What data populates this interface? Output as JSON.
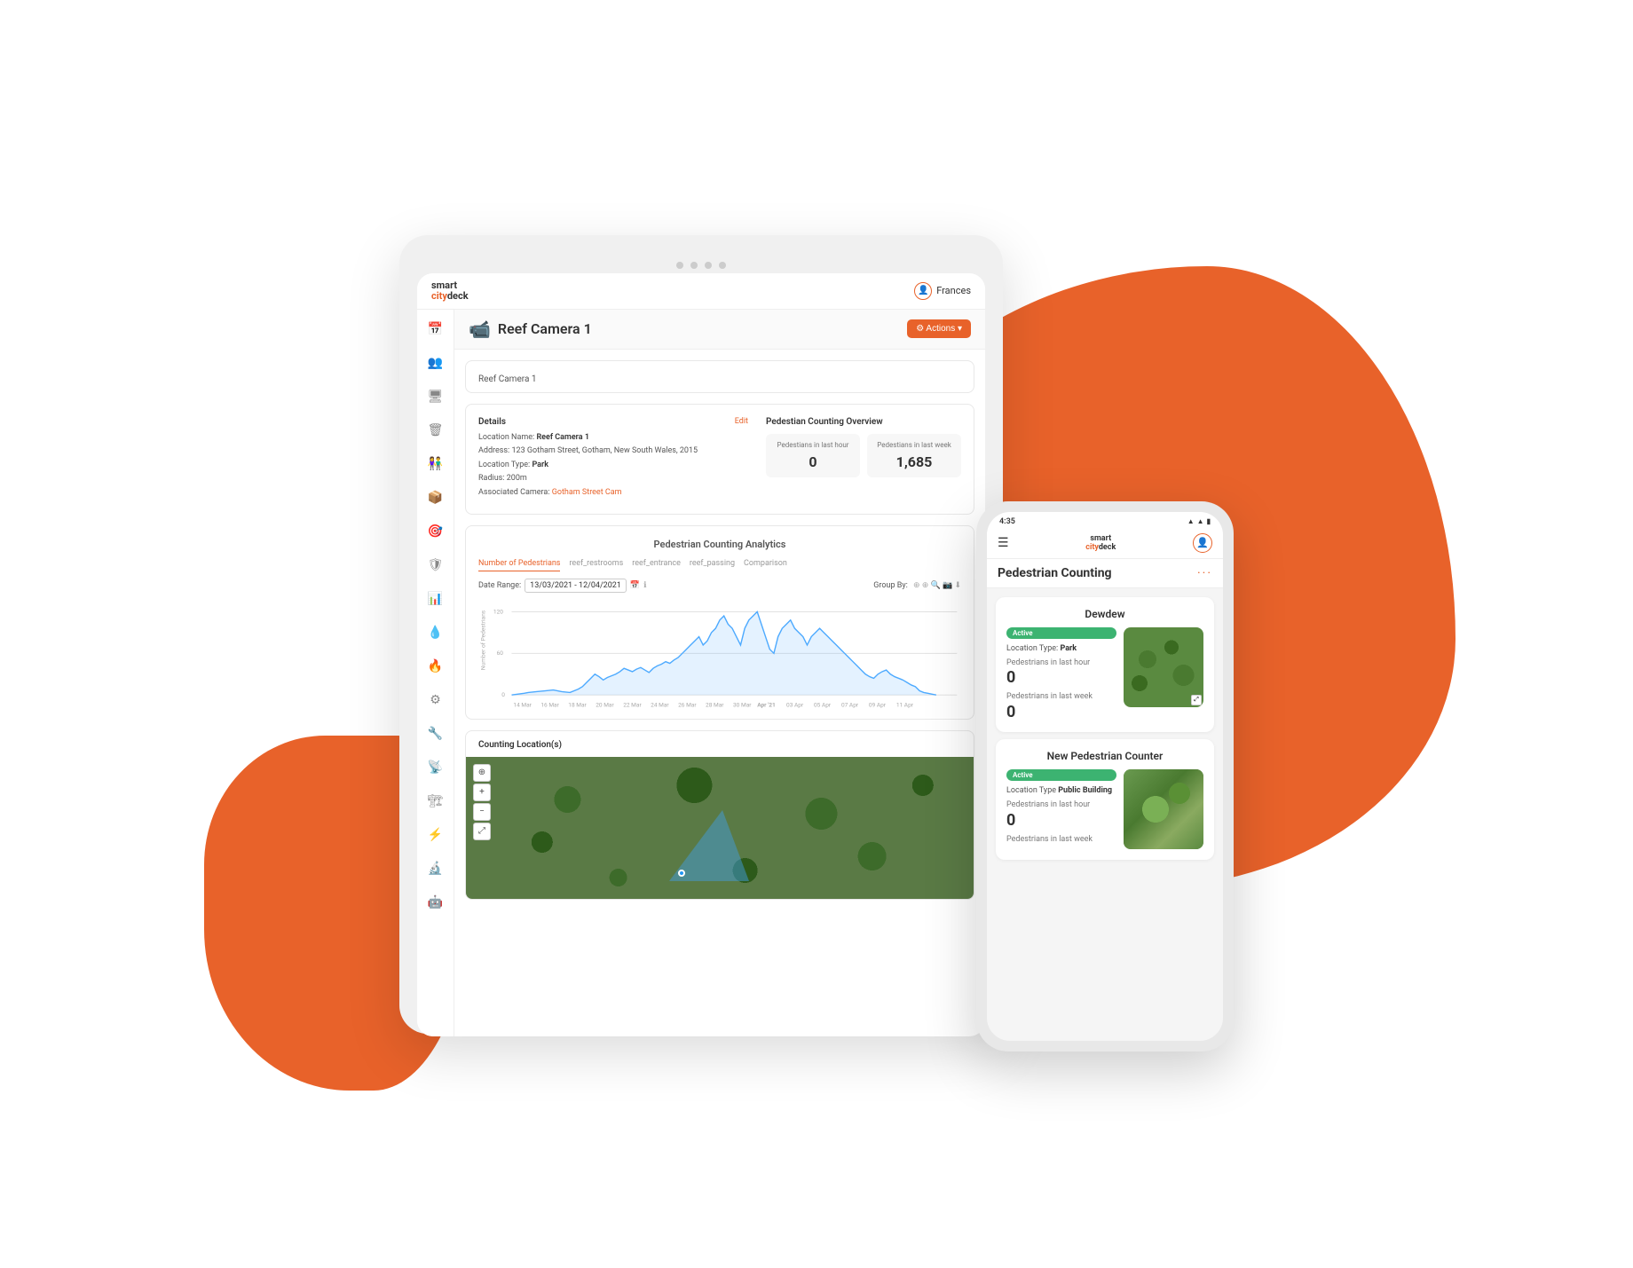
{
  "app": {
    "name": "smartcitydeck",
    "name_smart": "smart",
    "name_city": "city",
    "name_deck": "deck"
  },
  "tablet": {
    "dots": [
      "",
      "",
      "",
      ""
    ],
    "header": {
      "logo_line1": "smart",
      "logo_line2": "citydeck",
      "user_name": "Frances"
    },
    "page": {
      "title": "Reef Camera 1",
      "actions_label": "⚙ Actions ▾"
    },
    "breadcrumb": "Reef Camera 1",
    "details": {
      "label": "Details",
      "edit": "Edit",
      "location_name_label": "Location Name:",
      "location_name": "Reef Camera 1",
      "address_label": "Address:",
      "address": "123 Gotham Street, Gotham, New South Wales, 2015",
      "type_label": "Location Type:",
      "type": "Park",
      "radius_label": "Radius:",
      "radius": "200m",
      "camera_label": "Associated Camera:",
      "camera": "Gotham Street Cam"
    },
    "overview": {
      "label": "Pedestian Counting Overview",
      "last_hour_label": "Pedestians in last hour",
      "last_hour_value": "0",
      "last_week_label": "Pedestians in last week",
      "last_week_value": "1,685"
    },
    "chart": {
      "title": "Pedestrian Counting Analytics",
      "tabs": [
        "Number of Pedestrians",
        "reef_restrooms",
        "reef_entrance",
        "reef_passing",
        "Comparison"
      ],
      "date_range_label": "Date Range:",
      "date_range": "13/03/2021 - 12/04/2021",
      "group_by_label": "Group By:",
      "y_axis_max": "120",
      "y_axis_mid": "60",
      "y_axis_min": "0",
      "y_axis_label": "Number of Pedestrians",
      "x_labels": [
        "14 Mar",
        "16 Mar",
        "18 Mar",
        "20 Mar",
        "22 Mar",
        "24 Mar",
        "26 Mar",
        "28 Mar",
        "30 Mar",
        "Apr 21",
        "03 Apr",
        "05 Apr",
        "07 Apr",
        "09 Apr",
        "11 Apr"
      ]
    },
    "map": {
      "title": "Counting Location(s)"
    }
  },
  "phone": {
    "status_time": "4:35",
    "header": {
      "logo_line1": "smart",
      "logo_line2": "citydeck"
    },
    "page_title": "Pedestrian Counting",
    "cards": [
      {
        "name": "Dewdew",
        "active": true,
        "active_label": "Active",
        "location_type_label": "Location Type:",
        "location_type": "Park",
        "last_hour_label": "Pedestrians in last hour",
        "last_hour_value": "0",
        "last_week_label": "Pedestrians in last week",
        "last_week_value": "0"
      },
      {
        "name": "New Pedestrian Counter",
        "active": true,
        "active_label": "Active",
        "location_type_label": "Location Type",
        "location_type": "Public Building",
        "last_hour_label": "Pedestrians in last hour",
        "last_hour_value": "0",
        "last_week_label": "Pedestrians in last week",
        "last_week_value": ""
      }
    ]
  },
  "sidebar": {
    "icons": [
      "📅",
      "👥",
      "🖥",
      "🗑",
      "👫",
      "📦",
      "🎯",
      "🛡",
      "📊",
      "💧",
      "🔥",
      "⚙",
      "🔧",
      "📡",
      "🏗",
      "⚡",
      "🔬",
      "🤖"
    ]
  }
}
